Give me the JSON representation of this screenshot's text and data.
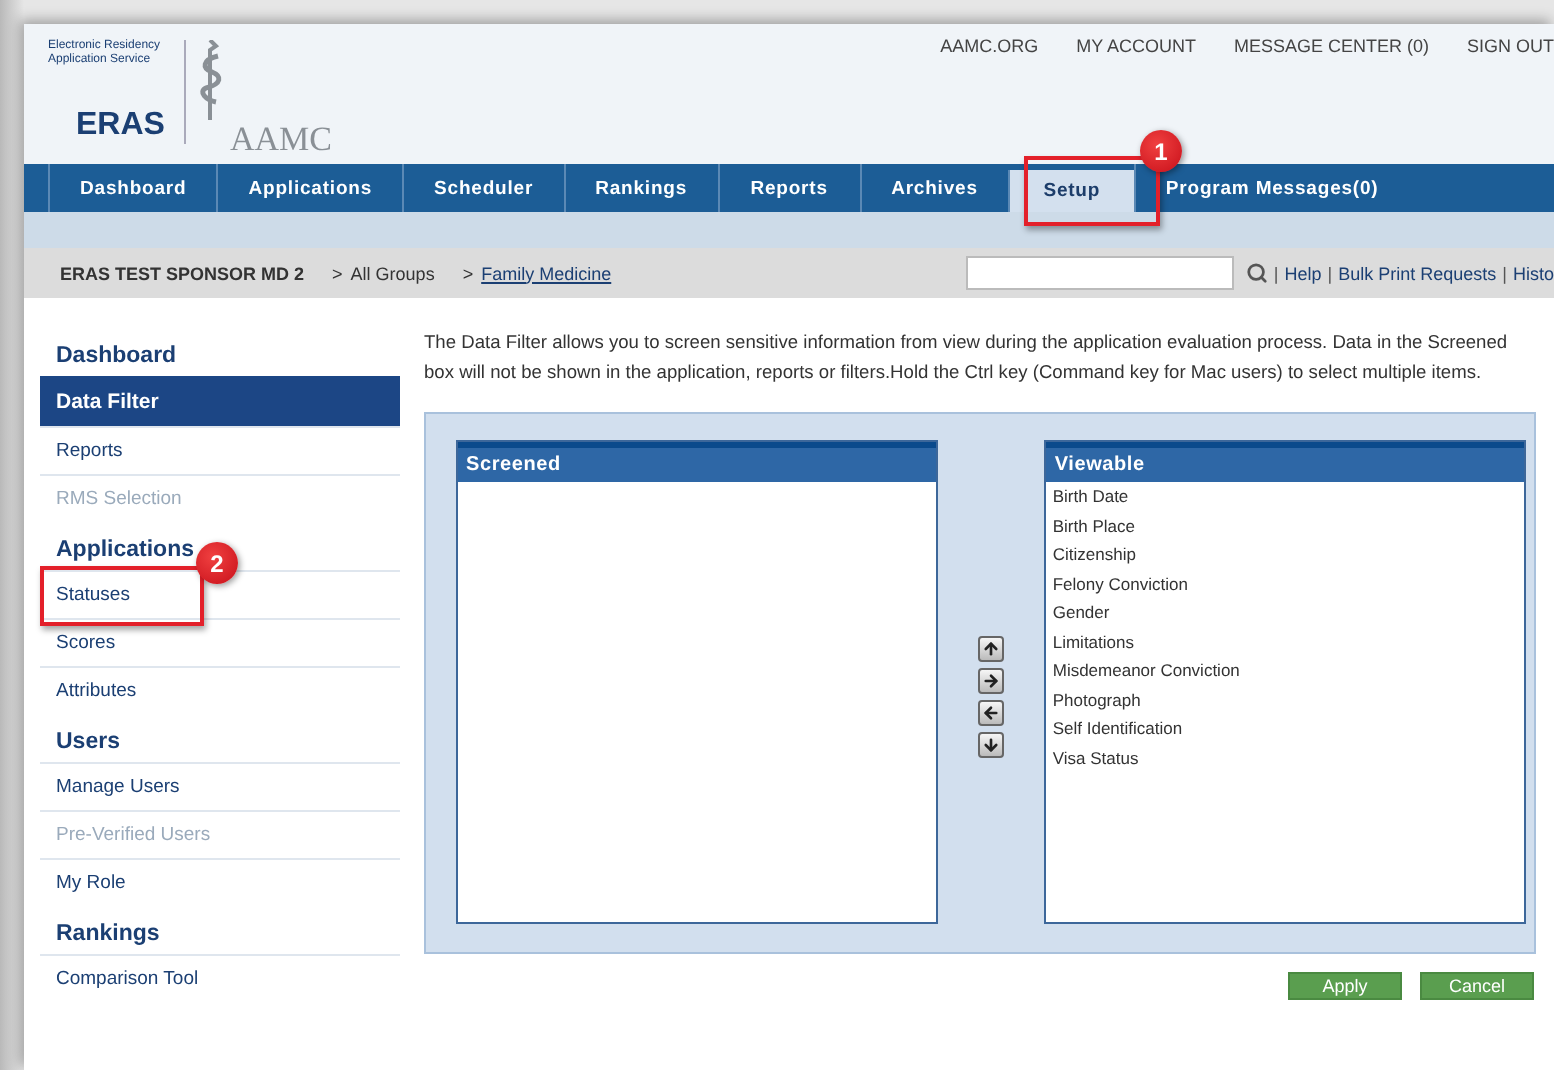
{
  "header": {
    "logo_tagline": "Electronic Residency Application Service",
    "logo_eras": "ERAS",
    "logo_aamc": "AAMC",
    "top_links": [
      "AAMC.ORG",
      "MY ACCOUNT",
      "MESSAGE CENTER (0)",
      "SIGN OUT"
    ]
  },
  "tabs": [
    {
      "label": "Dashboard",
      "selected": false
    },
    {
      "label": "Applications",
      "selected": false
    },
    {
      "label": "Scheduler",
      "selected": false
    },
    {
      "label": "Rankings",
      "selected": false
    },
    {
      "label": "Reports",
      "selected": false
    },
    {
      "label": "Archives",
      "selected": false
    },
    {
      "label": "Setup",
      "selected": true
    },
    {
      "label": "Program Messages(0)",
      "selected": false
    }
  ],
  "breadcrumb": {
    "sponsor": "ERAS TEST SPONSOR MD 2",
    "items": [
      {
        "marker": ">",
        "label": "All Groups",
        "link": false
      },
      {
        "marker": ">",
        "label": "Family Medicine",
        "link": true
      }
    ]
  },
  "utility_links": [
    {
      "separator": "|",
      "label": "Help"
    },
    {
      "separator": "|",
      "label": "Bulk Print Requests"
    },
    {
      "separator": "|",
      "label": "Histo"
    }
  ],
  "sidebar": [
    {
      "heading": "Dashboard",
      "items": [
        {
          "label": "Data Filter",
          "selected": true,
          "disabled": false
        },
        {
          "label": "Reports",
          "selected": false,
          "disabled": false
        },
        {
          "label": "RMS Selection",
          "selected": false,
          "disabled": true
        }
      ]
    },
    {
      "heading": "Applications",
      "items": [
        {
          "label": "Statuses",
          "selected": false,
          "disabled": false
        },
        {
          "label": "Scores",
          "selected": false,
          "disabled": false
        },
        {
          "label": "Attributes",
          "selected": false,
          "disabled": false
        }
      ]
    },
    {
      "heading": "Users",
      "items": [
        {
          "label": "Manage Users",
          "selected": false,
          "disabled": false
        },
        {
          "label": "Pre-Verified Users",
          "selected": false,
          "disabled": true
        },
        {
          "label": "My Role",
          "selected": false,
          "disabled": false
        }
      ]
    },
    {
      "heading": "Rankings",
      "items": [
        {
          "label": "Comparison Tool",
          "selected": false,
          "disabled": false
        }
      ]
    }
  ],
  "description": "The Data Filter allows you to screen sensitive information from view during the application evaluation process. Data in the Screened box will not be shown in the application, reports or filters.Hold the Ctrl key (Command key for Mac users) to select multiple items.",
  "screened": {
    "title": "Screened"
  },
  "viewable": {
    "title": "Viewable",
    "items": [
      "Birth Date",
      "Birth Place",
      "Citizenship",
      "Felony Conviction",
      "Gender",
      "Limitations",
      "Misdemeanor Conviction",
      "Photograph",
      "Self Identification",
      "Visa Status"
    ]
  },
  "move_buttons": [
    {
      "kind": "up"
    },
    {
      "kind": "right"
    },
    {
      "kind": "left"
    },
    {
      "kind": "down"
    }
  ],
  "buttons": [
    "Apply",
    "Cancel"
  ],
  "annotations": [
    {
      "number": "1"
    },
    {
      "number": "2"
    }
  ]
}
